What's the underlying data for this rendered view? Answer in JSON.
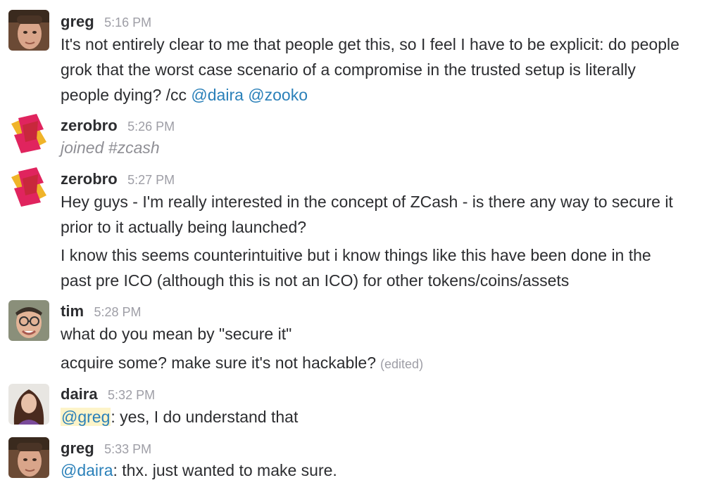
{
  "messages": [
    {
      "author": "greg",
      "time": "5:16 PM",
      "avatar_icon": "user-avatar-greg",
      "lines": [
        "It's not entirely clear to me that people get this, so I feel I have to be explicit: do people",
        "grok that the worst case scenario of a compromise in the trusted setup is literally",
        "people dying? /cc "
      ],
      "mentions": [
        "@daira",
        "@zooko"
      ]
    },
    {
      "author": "zerobro",
      "time": "5:26 PM",
      "avatar_icon": "user-avatar-zerobro",
      "system_text": "joined #zcash"
    },
    {
      "author": "zerobro",
      "time": "5:27 PM",
      "avatar_icon": "user-avatar-zerobro",
      "lines": [
        "Hey guys - I'm really interested in the concept of ZCash - is there any way to secure it",
        "prior to it actually being launched?",
        "I know this seems counterintuitive but i know things like this have been done in the",
        "past pre ICO (although this is not an ICO) for other tokens/coins/assets"
      ]
    },
    {
      "author": "tim",
      "time": "5:28 PM",
      "avatar_icon": "user-avatar-tim",
      "lines": [
        "what do you mean by \"secure it\"",
        "acquire some?  make sure it's not hackable?"
      ],
      "edited_label": "(edited)"
    },
    {
      "author": "daira",
      "time": "5:32 PM",
      "avatar_icon": "user-avatar-daira",
      "mention": "@greg",
      "text": ": yes, I do understand that"
    },
    {
      "author": "greg",
      "time": "5:33 PM",
      "avatar_icon": "user-avatar-greg",
      "mention": "@daira",
      "text": ": thx. just wanted to make sure."
    }
  ],
  "colors": {
    "mention": "#2a80b9",
    "mention_highlight_bg": "#fdf4c9",
    "timestamp": "#9e9ea6",
    "text": "#2c2d30",
    "zerobro_avatar_bg": "#f0b429",
    "zerobro_avatar_fg": "#e0245e"
  }
}
